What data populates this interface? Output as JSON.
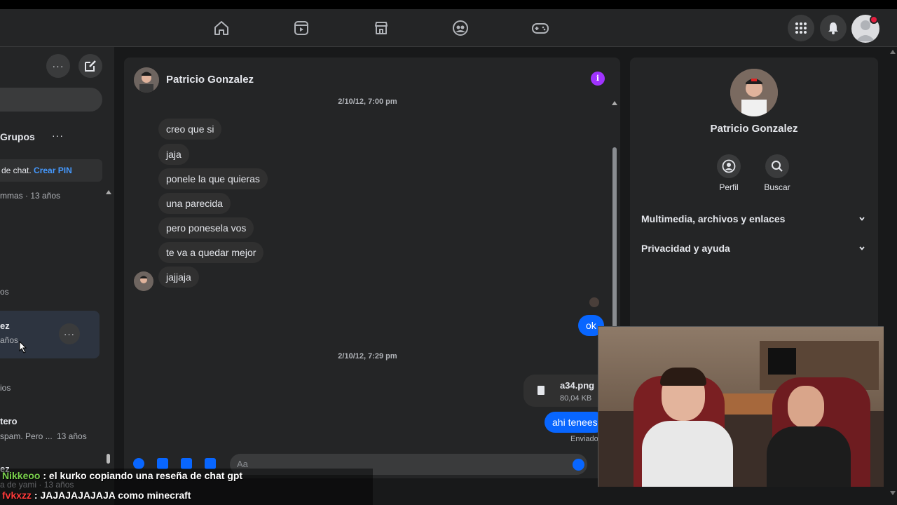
{
  "left": {
    "heading": "Grupos",
    "heading_dots": "···",
    "pin_text": "de chat.",
    "pin_link": "Crear PIN",
    "items": [
      {
        "title": "",
        "sub": "mmas · 13 años"
      },
      {
        "title": "",
        "sub": "os"
      },
      {
        "title": "ez",
        "sub": "años"
      },
      {
        "title": "",
        "sub": "ios"
      },
      {
        "title": "tero",
        "sub": "spam. Pero ...",
        "time": "13 años"
      },
      {
        "title": "ez",
        "sub": "a de yami · 13 años"
      }
    ],
    "item_dots": "···"
  },
  "chat": {
    "name": "Patricio Gonzalez",
    "info_icon": "i",
    "timestamp1": "2/10/12, 7:00 pm",
    "incoming": [
      "creo que si",
      "jaja",
      "ponele la que quieras",
      "una parecida",
      "pero ponesela vos",
      "te va a quedar mejor",
      "jajjaja"
    ],
    "outgoing1": "ok",
    "timestamp2": "2/10/12, 7:29 pm",
    "file": {
      "name": "a34.png",
      "size": "80,04 KB"
    },
    "outgoing2": "ahi tenees",
    "sent_label": "Enviado",
    "composer_placeholder": "Aa"
  },
  "right": {
    "name": "Patricio Gonzalez",
    "actions": [
      {
        "label": "Perfil",
        "icon": "profile-icon"
      },
      {
        "label": "Buscar",
        "icon": "search-icon"
      }
    ],
    "sections": [
      "Multimedia, archivos y enlaces",
      "Privacidad y ayuda"
    ]
  },
  "overlay": {
    "line1_user": "Nikkeoo",
    "line1_msg": " : el kurko copiando una reseña de chat gpt",
    "line2_user": "fvkxzz",
    "line2_msg": " : JAJAJAJAJAJA como minecraft"
  },
  "colors": {
    "accent": "#0866ff",
    "info": "#a033ff",
    "link": "#4599ff",
    "background": "#18191a",
    "panel": "#242526"
  }
}
